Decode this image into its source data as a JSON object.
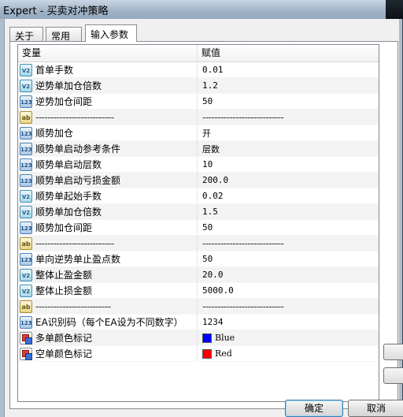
{
  "window": {
    "title": "Expert - 买卖对冲策略"
  },
  "tabs": [
    {
      "label": "关于"
    },
    {
      "label": "常用"
    },
    {
      "label": "输入参数"
    }
  ],
  "grid": {
    "header": {
      "variable": "变量",
      "value": "赋值"
    },
    "rows": [
      {
        "type": "double",
        "name": "首单手数",
        "value": "0.01"
      },
      {
        "type": "double",
        "name": "逆势单加仓倍数",
        "value": "1.2"
      },
      {
        "type": "int",
        "name": "逆势加仓间距",
        "value": "50"
      },
      {
        "type": "string",
        "name": "--------------------------",
        "value": "---------------------------"
      },
      {
        "type": "int",
        "name": "顺势加仓",
        "value": "开"
      },
      {
        "type": "int",
        "name": "顺势单启动参考条件",
        "value": "层数"
      },
      {
        "type": "int",
        "name": "顺势单启动层数",
        "value": "10"
      },
      {
        "type": "int",
        "name": "顺势单启动亏损金额",
        "value": "200.0"
      },
      {
        "type": "double",
        "name": "顺势单起始手数",
        "value": "0.02"
      },
      {
        "type": "double",
        "name": "顺势单加仓倍数",
        "value": "1.5"
      },
      {
        "type": "int",
        "name": "顺势加仓间距",
        "value": "50"
      },
      {
        "type": "string",
        "name": "--------------------------",
        "value": "---------------------------"
      },
      {
        "type": "int",
        "name": "单向逆势单止盈点数",
        "value": "50"
      },
      {
        "type": "double",
        "name": "整体止盈金额",
        "value": "20.0"
      },
      {
        "type": "double",
        "name": "整体止损金额",
        "value": "5000.0"
      },
      {
        "type": "string",
        "name": "-------------------------",
        "value": "---------------------------"
      },
      {
        "type": "int",
        "name": "EA识别码（每个EA设为不同数字）",
        "value": "1234"
      },
      {
        "type": "color",
        "name": "多单颜色标记",
        "value": "Blue",
        "swatch": "#0000ff"
      },
      {
        "type": "color",
        "name": "空单颜色标记",
        "value": "Red",
        "swatch": "#ff0000"
      }
    ]
  },
  "buttons": {
    "ok": "确定",
    "cancel": "取消"
  },
  "icons": {
    "int": "123",
    "double": "V2",
    "string": "ab"
  }
}
